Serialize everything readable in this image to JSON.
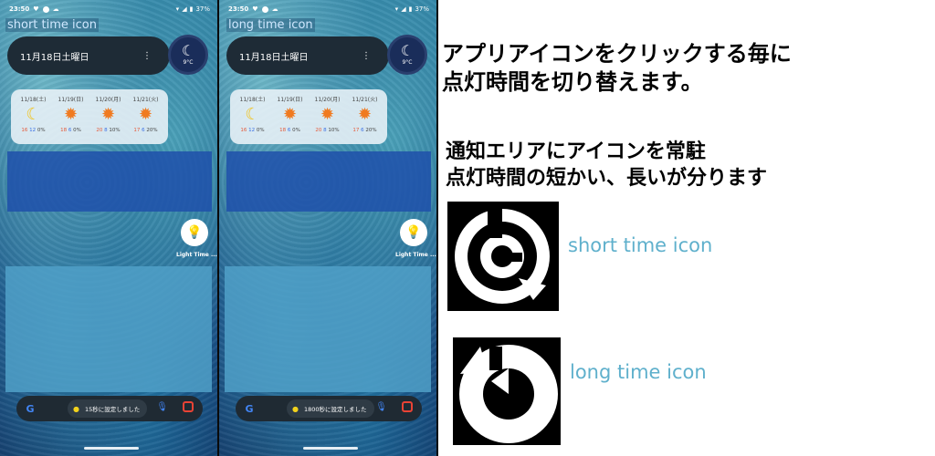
{
  "phones": [
    {
      "status_time": "23:50",
      "battery": "37%",
      "label": "short time icon",
      "date": "11月18日土曜日",
      "weather_temp": "9°C",
      "forecast": [
        {
          "date": "11/18(土)",
          "icon": "moon-icon",
          "hi": "16",
          "lo": "12",
          "rain": "0%"
        },
        {
          "date": "11/19(日)",
          "icon": "sun-icon",
          "hi": "18",
          "lo": "6",
          "rain": "0%"
        },
        {
          "date": "11/20(月)",
          "icon": "sun-icon",
          "hi": "20",
          "lo": "8",
          "rain": "10%"
        },
        {
          "date": "11/21(火)",
          "icon": "sun-icon",
          "hi": "17",
          "lo": "6",
          "rain": "20%"
        }
      ],
      "app_label": "Light Time ...",
      "toast": "15秒に設定しました"
    },
    {
      "status_time": "23:50",
      "battery": "37%",
      "label": "long time icon",
      "date": "11月18日土曜日",
      "weather_temp": "9°C",
      "forecast": [
        {
          "date": "11/18(土)",
          "icon": "moon-icon",
          "hi": "16",
          "lo": "12",
          "rain": "0%"
        },
        {
          "date": "11/19(日)",
          "icon": "sun-icon",
          "hi": "18",
          "lo": "6",
          "rain": "0%"
        },
        {
          "date": "11/20(月)",
          "icon": "sun-icon",
          "hi": "20",
          "lo": "8",
          "rain": "10%"
        },
        {
          "date": "11/21(火)",
          "icon": "sun-icon",
          "hi": "17",
          "lo": "6",
          "rain": "20%"
        }
      ],
      "app_label": "Light Time ...",
      "toast": "1800秒に設定しました"
    }
  ],
  "description": {
    "line1": "アプリアイコンをクリックする毎に",
    "line2": "点灯時間を切り替えます。",
    "line3": "通知エリアにアイコンを常駐",
    "line4": "点灯時間の短かい、長いが分ります"
  },
  "legend": {
    "short_caption": "short time icon",
    "long_caption": "long time icon",
    "caption_color": "#5fb0cc"
  }
}
